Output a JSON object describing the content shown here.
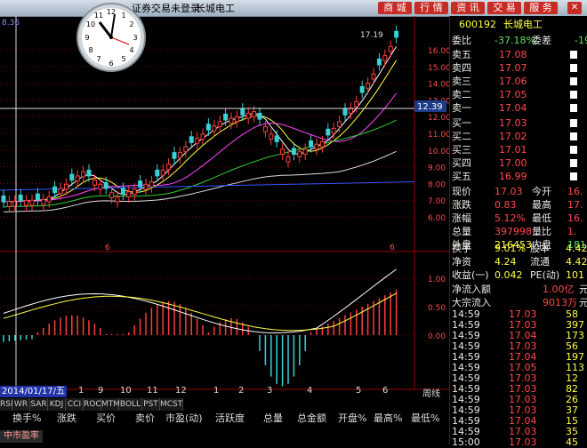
{
  "titlebar": {
    "title": "证券交易未登录",
    "stock": "长城电工",
    "nav": [
      "商 城",
      "行 情",
      "资 讯",
      "交 易",
      "服 务"
    ]
  },
  "chart": {
    "price_axis": [
      "16.00",
      "15.00",
      "14.00",
      "13.00",
      "12.00",
      "11.00",
      "10.00",
      "9.00",
      "8.00",
      "7.00",
      "6.00"
    ],
    "crosshair_price": "12.39",
    "high_label": "17.19",
    "vol_axis": [
      "1.00",
      "0.50",
      "0.00"
    ],
    "top_left_label": "8.36",
    "date_label": "2014/01/17/五",
    "cal_marks": [
      "1",
      "9",
      "10",
      "11",
      "12",
      "1",
      "2",
      "3",
      "4",
      "5",
      "6"
    ],
    "cycle_label": "周线",
    "marker_6": "6"
  },
  "bottom": {
    "tabs": [
      "RSI",
      "WR",
      "SAR",
      "KDJ",
      "CCI",
      "ROC",
      "MTM",
      "BOLL",
      "PST",
      "MCST"
    ],
    "headers": [
      "换手%",
      "涨跌",
      "买价",
      "卖价",
      "市盈(动)",
      "活跃度",
      "总量",
      "总金额",
      "开盘%",
      "最高%",
      "最低%"
    ],
    "footer_tab": "中市盈率"
  },
  "panel": {
    "code": "600192",
    "name": "长城电工",
    "weibi_label": "委比",
    "weibi": "-37.18%",
    "weicha_label": "委差",
    "weicha": "-19",
    "sell": [
      {
        "label": "卖五",
        "price": "17.08"
      },
      {
        "label": "卖四",
        "price": "17.07"
      },
      {
        "label": "卖三",
        "price": "17.06"
      },
      {
        "label": "卖二",
        "price": "17.05"
      },
      {
        "label": "卖一",
        "price": "17.04"
      }
    ],
    "buy": [
      {
        "label": "买一",
        "price": "17.03"
      },
      {
        "label": "买二",
        "price": "17.02"
      },
      {
        "label": "买三",
        "price": "17.01"
      },
      {
        "label": "买四",
        "price": "17.00"
      },
      {
        "label": "买五",
        "price": "16.99"
      }
    ],
    "stats": [
      {
        "l1": "现价",
        "v1": "17.03",
        "l2": "今开",
        "v2": "16."
      },
      {
        "l1": "涨跌",
        "v1": "0.83",
        "l2": "最高",
        "v2": "17."
      },
      {
        "l1": "涨幅",
        "v1": "5.12%",
        "l2": "最低",
        "v2": "16."
      },
      {
        "l1": "总量",
        "v1": "397998",
        "l2": "量比",
        "v2": "1."
      },
      {
        "l1": "外盘",
        "v1": "216453",
        "l2": "内盘",
        "v2": "1815"
      }
    ],
    "fund": [
      {
        "l1": "换手",
        "v1": "9.01%",
        "l2": "股本",
        "v2": "4.42"
      },
      {
        "l1": "净资",
        "v1": "4.24",
        "l2": "流通",
        "v2": "4.42"
      },
      {
        "l1": "收益(一)",
        "v1": "0.042",
        "l2": "PE(动)",
        "v2": "101"
      }
    ],
    "flow": [
      {
        "l": "净流入额",
        "v": "1.00亿",
        "x": "元"
      },
      {
        "l": "大宗流入",
        "v": "9013万",
        "x": "元"
      }
    ],
    "ticks": [
      {
        "t": "14:59",
        "p": "17.03",
        "v": "58"
      },
      {
        "t": "14:59",
        "p": "17.03",
        "v": "397"
      },
      {
        "t": "14:59",
        "p": "17.04",
        "v": "173"
      },
      {
        "t": "14:59",
        "p": "17.03",
        "v": "56"
      },
      {
        "t": "14:59",
        "p": "17.04",
        "v": "197"
      },
      {
        "t": "14:59",
        "p": "17.05",
        "v": "113"
      },
      {
        "t": "14:59",
        "p": "17.03",
        "v": "12"
      },
      {
        "t": "14:59",
        "p": "17.03",
        "v": "82"
      },
      {
        "t": "14:59",
        "p": "17.03",
        "v": "26"
      },
      {
        "t": "14:59",
        "p": "17.03",
        "v": "37"
      },
      {
        "t": "14:59",
        "p": "17.04",
        "v": "15"
      },
      {
        "t": "14:59",
        "p": "17.03",
        "v": "35"
      },
      {
        "t": "15:00",
        "p": "17.03",
        "v": "45"
      }
    ]
  },
  "colors": {
    "up": "#ff3b3b",
    "down": "#39d0d8",
    "ma1": "#ffffff",
    "ma2": "#ffff44",
    "ma3": "#ff44ff",
    "ma4": "#33cc33",
    "ma5": "#dddddd",
    "ma6": "#3355ff",
    "grid": "#7a0000"
  }
}
